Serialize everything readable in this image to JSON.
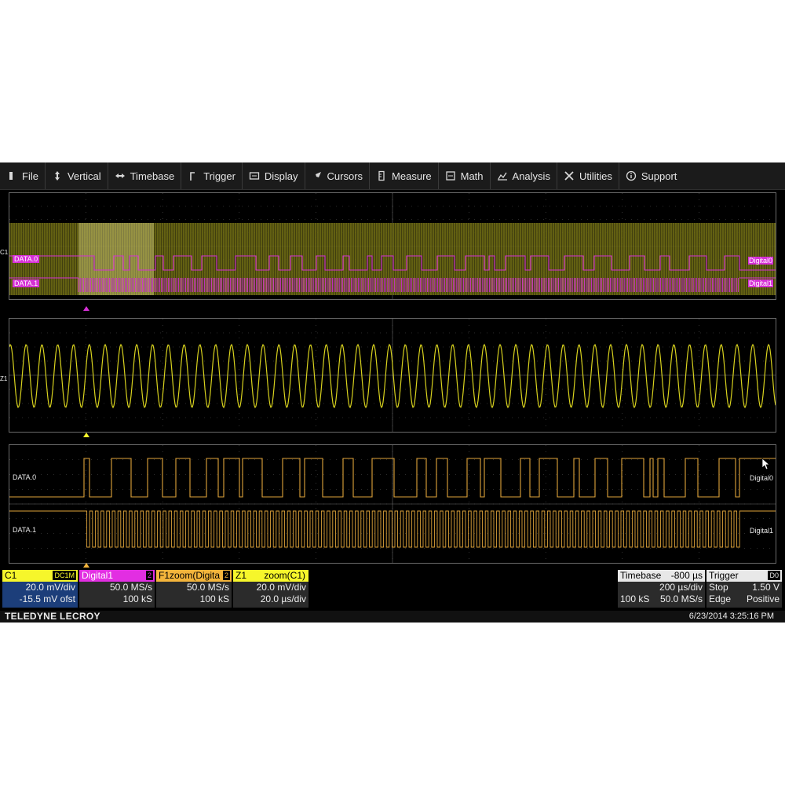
{
  "menu": [
    {
      "label": "File",
      "icon": "file-icon"
    },
    {
      "label": "Vertical",
      "icon": "vertical-arrows-icon"
    },
    {
      "label": "Timebase",
      "icon": "horizontal-arrows-icon"
    },
    {
      "label": "Trigger",
      "icon": "trigger-icon"
    },
    {
      "label": "Display",
      "icon": "display-icon"
    },
    {
      "label": "Cursors",
      "icon": "cursor-icon"
    },
    {
      "label": "Measure",
      "icon": "measure-icon"
    },
    {
      "label": "Math",
      "icon": "math-icon"
    },
    {
      "label": "Analysis",
      "icon": "analysis-icon"
    },
    {
      "label": "Utilities",
      "icon": "utilities-icon"
    },
    {
      "label": "Support",
      "icon": "support-icon"
    }
  ],
  "panel1": {
    "channel_tag": "C1",
    "trace_labels": [
      "DATA.0",
      "DATA.1"
    ],
    "side_labels": [
      "Digital0",
      "Digital1"
    ]
  },
  "panel2": {
    "channel_tag": "Z1"
  },
  "panel3": {
    "trace_labels": [
      "DATA.0",
      "DATA.1"
    ],
    "side_labels": [
      "Digital0",
      "Digital1"
    ]
  },
  "descriptors": {
    "c1": {
      "title": "C1",
      "badge": "DC1M",
      "line1": "20.0 mV/div",
      "line2": "-15.5 mV ofst",
      "color": "#f6f62b"
    },
    "digital1": {
      "title": "Digital1",
      "badge": "2",
      "line1": "50.0 MS/s",
      "line2": "100 kS",
      "color": "#e22ee2"
    },
    "f1": {
      "title": "F1zoom(Digita",
      "badge": "2",
      "line1": "50.0 MS/s",
      "line2": "100 kS",
      "color": "#f3b43b"
    },
    "z1": {
      "title": "Z1",
      "title_right": "zoom(C1)",
      "line1": "20.0 mV/div",
      "line2": "20.0 µs/div",
      "color": "#f6f62b"
    },
    "timebase": {
      "title": "Timebase",
      "offset": "-800 µs",
      "line1": "200 µs/div",
      "line2_left": "100 kS",
      "line2_right": "50.0 MS/s"
    },
    "trigger": {
      "title": "Trigger",
      "badge": "D0",
      "line1_left": "Stop",
      "line1_right": "1.50 V",
      "line2_left": "Edge",
      "line2_right": "Positive"
    }
  },
  "brand": "TELEDYNE LECROY",
  "datetime": "6/23/2014 3:25:16 PM",
  "colors": {
    "c1_trace": "#d8d21e",
    "digital_trace": "#d630d6",
    "zoom_digital_trace": "#e0a53a",
    "grid": "#555555"
  }
}
